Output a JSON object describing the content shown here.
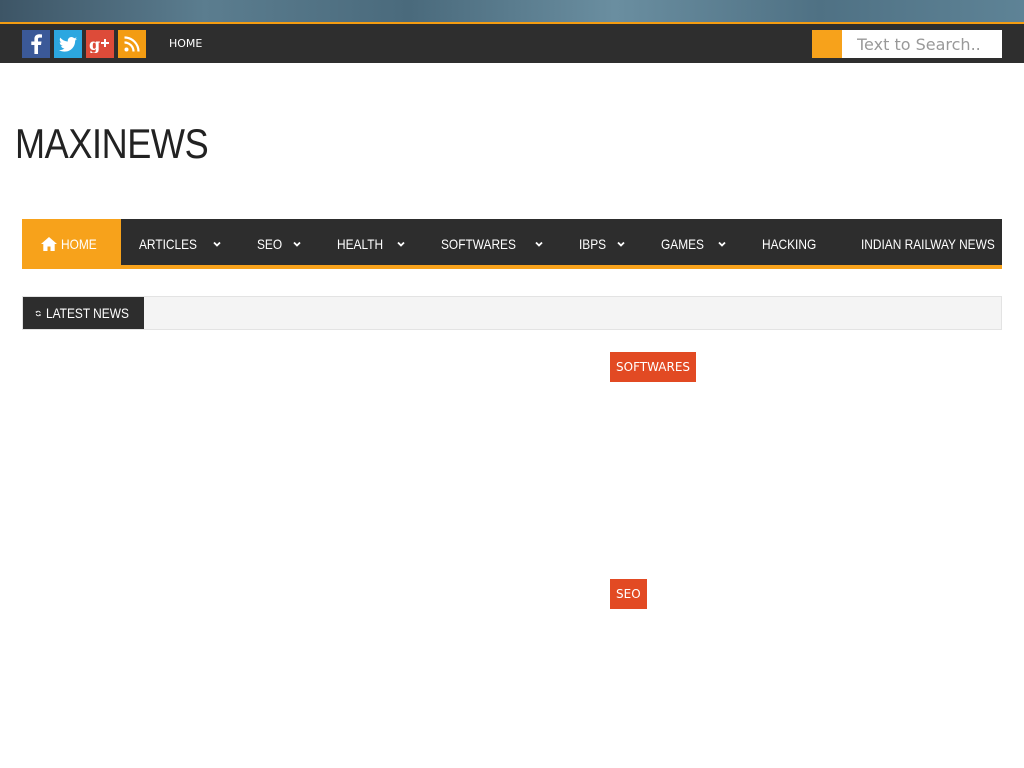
{
  "social": [
    {
      "name": "facebook",
      "glyph": "f",
      "color": "#3b5998"
    },
    {
      "name": "twitter",
      "glyph": "t",
      "color": "#2ca7e0"
    },
    {
      "name": "google-plus",
      "glyph": "g+",
      "color": "#dd4b39"
    },
    {
      "name": "rss",
      "glyph": "rss",
      "color": "#f39c12"
    }
  ],
  "top_nav": {
    "home_label": "HOME"
  },
  "search": {
    "placeholder": "Text to Search.."
  },
  "site": {
    "logo": "MAXINEWS"
  },
  "main_nav": {
    "items": [
      {
        "label": "HOME",
        "active": true,
        "dropdown": false
      },
      {
        "label": "ARTICLES",
        "active": false,
        "dropdown": true
      },
      {
        "label": "SEO",
        "active": false,
        "dropdown": true
      },
      {
        "label": "HEALTH",
        "active": false,
        "dropdown": true
      },
      {
        "label": "SOFTWARES",
        "active": false,
        "dropdown": true
      },
      {
        "label": "IBPS",
        "active": false,
        "dropdown": true
      },
      {
        "label": "GAMES",
        "active": false,
        "dropdown": true
      },
      {
        "label": "HACKING",
        "active": false,
        "dropdown": false
      },
      {
        "label": "INDIAN RAILWAY NEWS",
        "active": false,
        "dropdown": false
      }
    ]
  },
  "latest_news": {
    "label": "LATEST NEWS"
  },
  "categories": [
    {
      "label": "SOFTWARES"
    },
    {
      "label": "SEO"
    }
  ],
  "colors": {
    "accent": "#f7a21b",
    "tag": "#e24a23",
    "dark": "#2d2d2d"
  }
}
